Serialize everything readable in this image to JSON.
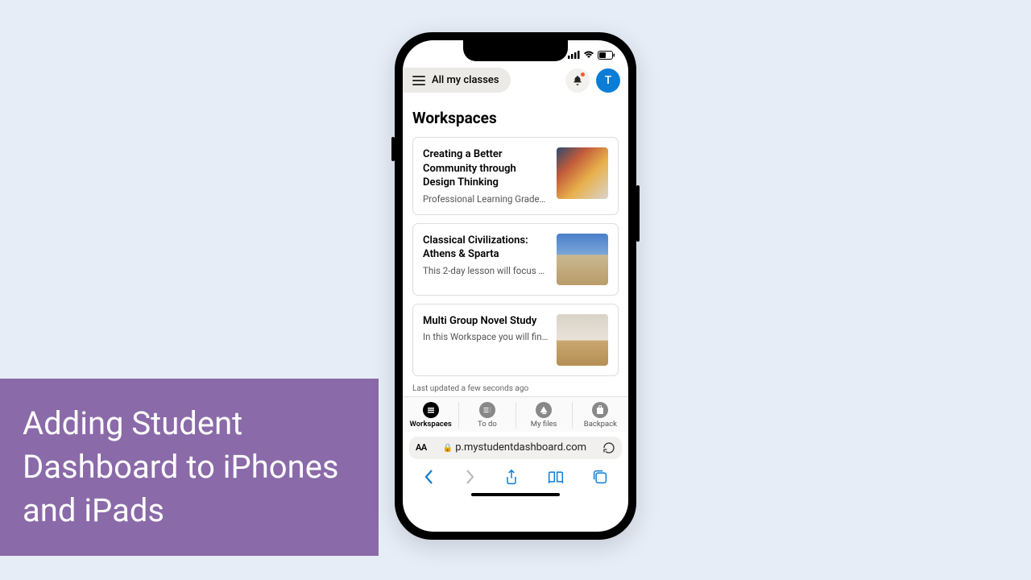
{
  "caption": "Adding Student Dashboard to iPhones and iPads",
  "header": {
    "menu_label": "All my classes",
    "avatar_initial": "T"
  },
  "section_title": "Workspaces",
  "cards": [
    {
      "title": "Creating a Better Community through Design Thinking",
      "subtitle": "Professional Learning Grades/…"
    },
    {
      "title": "Classical Civilizations: Athens & Sparta",
      "subtitle": "This 2-day lesson will focus on…"
    },
    {
      "title": "Multi Group Novel Study",
      "subtitle": "In this Workspace you will find …"
    }
  ],
  "updated_text": "Last updated a few seconds ago",
  "tabs": [
    {
      "label": "Workspaces"
    },
    {
      "label": "To do"
    },
    {
      "label": "My files"
    },
    {
      "label": "Backpack"
    }
  ],
  "address": {
    "aa": "AA",
    "url": "p.mystudentdashboard.com"
  }
}
